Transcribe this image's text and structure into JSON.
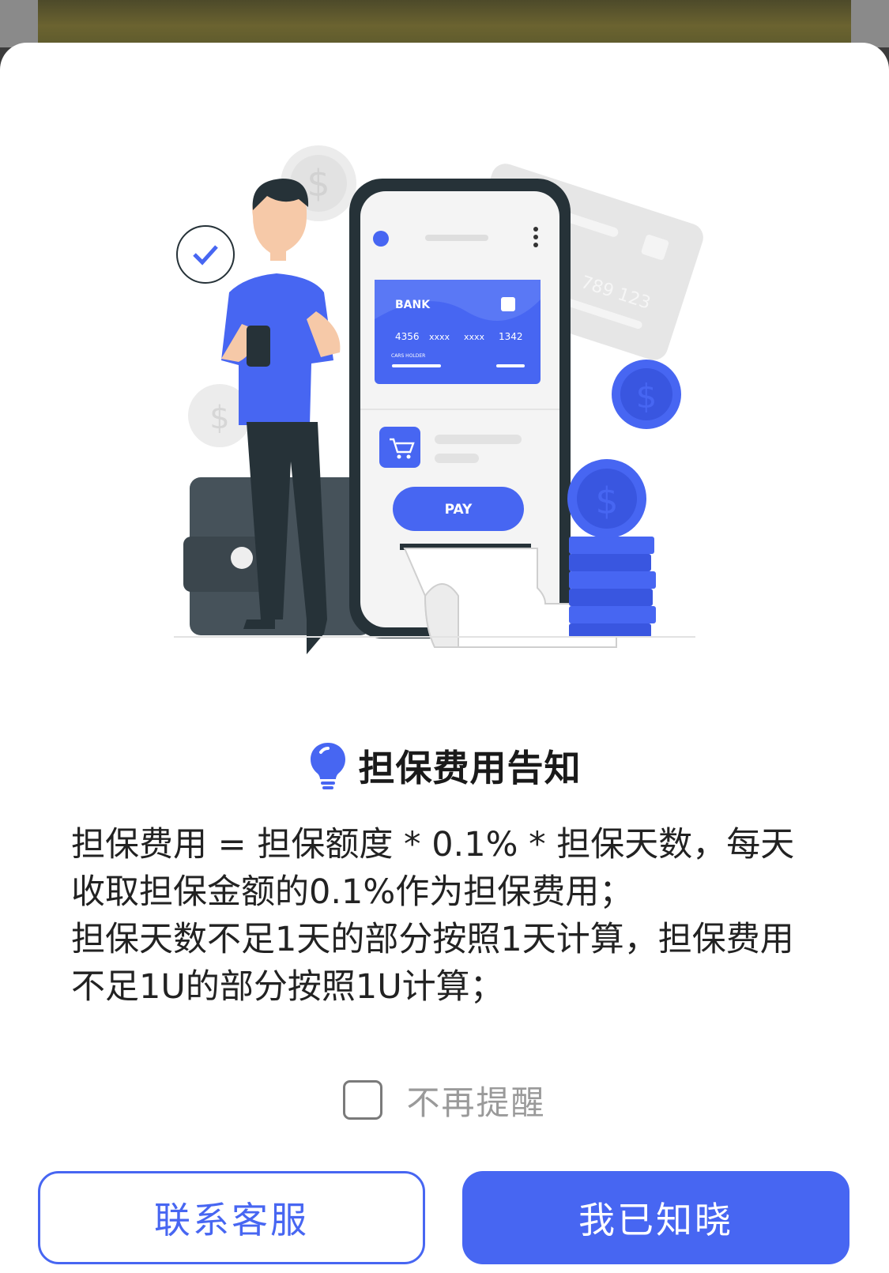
{
  "illustration": {
    "card_bank": "BANK",
    "card_number": [
      "4356",
      "xxxx",
      "xxxx",
      "1342"
    ],
    "card_holder": "CARS HOLDER",
    "bg_card_number": "789 123",
    "pay_button": "PAY",
    "coin_symbol": "$"
  },
  "notice": {
    "icon": "lightbulb-icon",
    "title": "担保费用告知",
    "lines": [
      "担保费用 = 担保额度 * 0.1% * 担保天数，每天收取担保金额的0.1%作为担保费用；",
      "担保天数不足1天的部分按照1天计算，担保费用不足1U的部分按照1U计算；"
    ]
  },
  "dont_remind": {
    "label": "不再提醒",
    "checked": false
  },
  "buttons": {
    "contact": "联系客服",
    "acknowledge": "我已知晓"
  },
  "colors": {
    "accent": "#4766f2",
    "title": "#1a1a1a",
    "muted": "#9a9a9a"
  }
}
